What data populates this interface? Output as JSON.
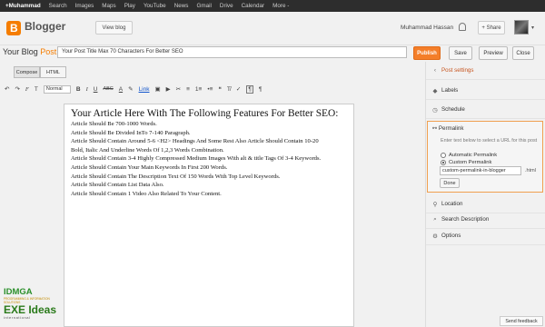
{
  "google_bar": {
    "items": [
      "+Muhammad",
      "Search",
      "Images",
      "Maps",
      "Play",
      "YouTube",
      "News",
      "Gmail",
      "Drive",
      "Calendar",
      "More -"
    ]
  },
  "header": {
    "brand": "Blogger",
    "view_blog": "View blog",
    "user_name": "Muhammad Hassan",
    "share": "+ Share",
    "avatar_caret": "▾"
  },
  "title_row": {
    "blog_name": "Your Blog",
    "post_word": "Post",
    "post_title": "Your Post Title Max 70 Characters For Better SEO",
    "publish": "Publish",
    "save": "Save",
    "preview": "Preview",
    "close": "Close"
  },
  "editor_tabs": {
    "compose": "Compose",
    "html": "HTML"
  },
  "toolbar": {
    "undo": "↶",
    "redo": "↷",
    "font_icon": "F",
    "size_icon": "T",
    "format_value": "Normal",
    "bold": "B",
    "italic": "I",
    "underline": "U",
    "strike": "ABC",
    "text_color": "A",
    "highlight": "✎",
    "link": "Link",
    "image": "▣",
    "video": "▶",
    "jump": "✂",
    "align": "≡",
    "numbered": "1≡",
    "bulleted": "•≡",
    "quote": "❝",
    "clear": "T̸",
    "spell": "✓",
    "ltr": "¶",
    "rtl": "¶"
  },
  "editor": {
    "heading": "Your Article Here With The Following Features For Better SEO:",
    "lines": [
      "Article Should Be 700-1000 Words.",
      "Article Should Be Divided InTo 7-140 Paragraph.",
      "Article Should Contain Around 5-6 <H2> Headings And Some Rest Also Article Should Contain 10-20",
      "Bold, Italic And Underline Words Of 1,2,3 Words Combination.",
      "Article Should Contain 3-4 Highly Compressed Medium Images With alt & title Tags Of 3-4 Keywords.",
      "Article Should Contain Your Main Keywords In First 200 Words.",
      "Article Should Contain The Description Text Of 150 Words With Top Level Keywords.",
      "Article Should Contain List Data Also.",
      "Article Should Contain 1 Video Also Related To Your Content."
    ]
  },
  "watermark": {
    "top": "IDMGA",
    "mid": "PROGRAMMING & INFORMATION SOLUTIONS",
    "big": "EXE Ideas",
    "bottom": "international"
  },
  "sidebar": {
    "heading": "Post settings",
    "labels": "Labels",
    "schedule": "Schedule",
    "permalink": "Permalink",
    "permalink_hint": "Enter text below to select a URL for this post",
    "automatic": "Automatic Permalink",
    "custom": "Custom Permalink",
    "custom_value": "custom-permalink-in-blogger",
    "html_ext": ".html",
    "done": "Done",
    "location": "Location",
    "search_description": "Search Description",
    "options": "Options"
  },
  "feedback": "Send feedback",
  "colors": {
    "accent": "#f47e29",
    "gbar": "#2d2d2d",
    "link": "#1155cc"
  }
}
